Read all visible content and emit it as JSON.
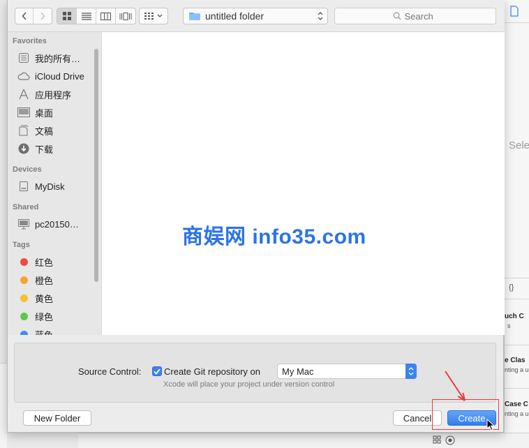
{
  "background": {
    "right_snippets": [
      "Sele",
      "uch C",
      "s",
      "e Clas",
      "nting a u",
      "Case C",
      "nting a u"
    ]
  },
  "toolbar": {
    "back_icon": "chevron-left-icon",
    "forward_icon": "chevron-right-icon",
    "view_icons": [
      "icon-view-icon",
      "list-view-icon",
      "column-view-icon",
      "cover-flow-icon"
    ],
    "arrange_icon": "arrange-grid-icon",
    "path_label": "untitled folder",
    "search_placeholder": "Search"
  },
  "sidebar": {
    "favorites_header": "Favorites",
    "favorites": [
      {
        "label": "我的所有…",
        "icon": "all-files-icon"
      },
      {
        "label": "iCloud Drive",
        "icon": "cloud-icon"
      },
      {
        "label": "应用程序",
        "icon": "applications-icon"
      },
      {
        "label": "桌面",
        "icon": "desktop-icon"
      },
      {
        "label": "文稿",
        "icon": "documents-icon"
      },
      {
        "label": "下载",
        "icon": "downloads-icon"
      }
    ],
    "devices_header": "Devices",
    "devices": [
      {
        "label": "MyDisk",
        "icon": "disk-icon"
      }
    ],
    "shared_header": "Shared",
    "shared": [
      {
        "label": "pc20150…",
        "icon": "computer-icon"
      }
    ],
    "tags_header": "Tags",
    "tags": [
      {
        "label": "红色",
        "color": "#f04b3f"
      },
      {
        "label": "橙色",
        "color": "#f4a531"
      },
      {
        "label": "黄色",
        "color": "#f5c132"
      },
      {
        "label": "绿色",
        "color": "#5fc84a"
      },
      {
        "label": "蓝色",
        "color": "#3b8df0"
      }
    ]
  },
  "filearea": {
    "watermark": "商娱网 info35.com"
  },
  "options": {
    "source_control_label": "Source Control:",
    "checkbox_label": "Create Git repository on",
    "checkbox_checked": true,
    "repo_target": "My Mac",
    "hint": "Xcode will place your project under version control"
  },
  "buttons": {
    "new_folder": "New Folder",
    "cancel": "Cancel",
    "create": "Create"
  },
  "colors": {
    "accent": "#3b83f0",
    "annotation": "#ea3a3a",
    "watermark": "#2a73ea"
  }
}
